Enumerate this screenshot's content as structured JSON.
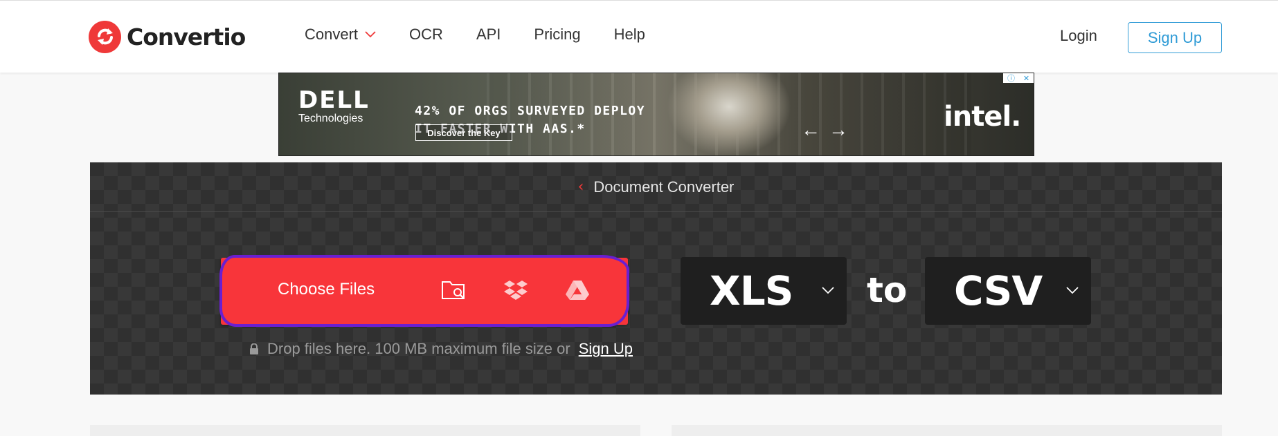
{
  "brand": {
    "name": "Convertio",
    "accent": "#ef3939"
  },
  "nav": {
    "items": [
      {
        "label": "Convert",
        "has_dropdown": true
      },
      {
        "label": "OCR"
      },
      {
        "label": "API"
      },
      {
        "label": "Pricing"
      },
      {
        "label": "Help"
      }
    ],
    "login_label": "Login",
    "signup_label": "Sign Up"
  },
  "ad": {
    "brand_line1": "DELL",
    "brand_line2": "Technologies",
    "headline": "42% OF ORGS SURVEYED DEPLOY\nIT FASTER WITH AAS.*",
    "cta_label": "Discover the Key",
    "sponsor": "intel."
  },
  "converter": {
    "breadcrumb_label": "Document Converter",
    "choose_files_label": "Choose Files",
    "sources": [
      "folder-search-icon",
      "dropbox-icon",
      "google-drive-icon"
    ],
    "drop_note": "Drop files here. 100 MB maximum file size or",
    "drop_signup_label": "Sign Up",
    "from_format": "XLS",
    "to_word": "to",
    "to_format": "CSV",
    "highlight_color": "#6a1fd1",
    "button_color": "#f8353a"
  }
}
